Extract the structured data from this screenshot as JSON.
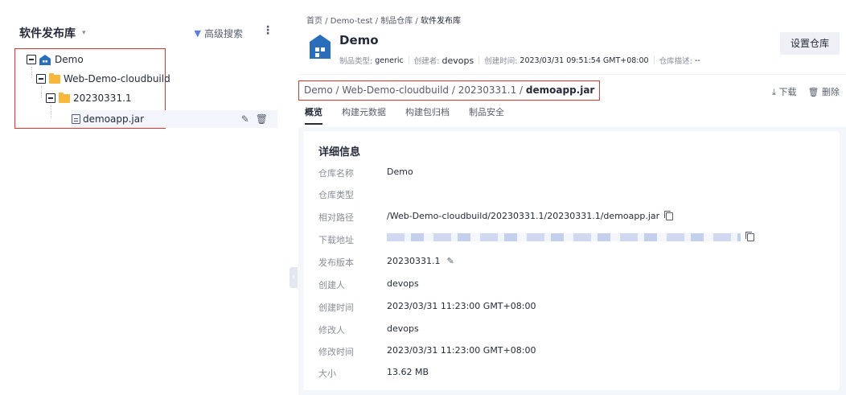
{
  "left": {
    "title": "软件发布库",
    "caret": "▾",
    "advanced_search": "高级搜索",
    "more": "⋮",
    "tree": {
      "root": "Demo",
      "folder1": "Web-Demo-cloudbuild",
      "folder2": "20230331.1",
      "file": "demoapp.jar"
    }
  },
  "breadcrumb": [
    "首页",
    "Demo-test",
    "制品仓库",
    "软件发布库"
  ],
  "repo": {
    "name": "Demo",
    "type_label": "制品类型:",
    "type_value": "generic",
    "creator_label": "创建者:",
    "creator_value": "devops",
    "created_label": "创建时间:",
    "created_value": "2023/03/31 09:51:54 GMT+08:00",
    "desc_label": "仓库描述:",
    "desc_value": "--",
    "settings_button": "设置仓库"
  },
  "path": {
    "prefix": "Demo / Web-Demo-cloudbuild / 20230331.1 / ",
    "file": "demoapp.jar"
  },
  "actions": {
    "download": "下载",
    "delete": "删除"
  },
  "tabs": [
    "概览",
    "构建元数据",
    "构建包归档",
    "制品安全"
  ],
  "details": {
    "title": "详细信息",
    "rows": [
      {
        "label": "仓库名称",
        "value": "Demo"
      },
      {
        "label": "仓库类型",
        "value": ""
      },
      {
        "label": "相对路径",
        "value": "/Web-Demo-cloudbuild/20230331.1/20230331.1/demoapp.jar"
      },
      {
        "label": "下载地址",
        "value": ""
      },
      {
        "label": "发布版本",
        "value": "20230331.1"
      },
      {
        "label": "创建人",
        "value": "devops"
      },
      {
        "label": "创建时间",
        "value": "2023/03/31 11:23:00 GMT+08:00"
      },
      {
        "label": "修改人",
        "value": "devops"
      },
      {
        "label": "修改时间",
        "value": "2023/03/31 11:23:00 GMT+08:00"
      },
      {
        "label": "大小",
        "value": "13.62 MB"
      }
    ]
  },
  "colors": {
    "highlight_border": "#e0352f",
    "accent": "#5e7ce0",
    "folder": "#f6b73c",
    "repo_icon": "#2a6ebb"
  }
}
